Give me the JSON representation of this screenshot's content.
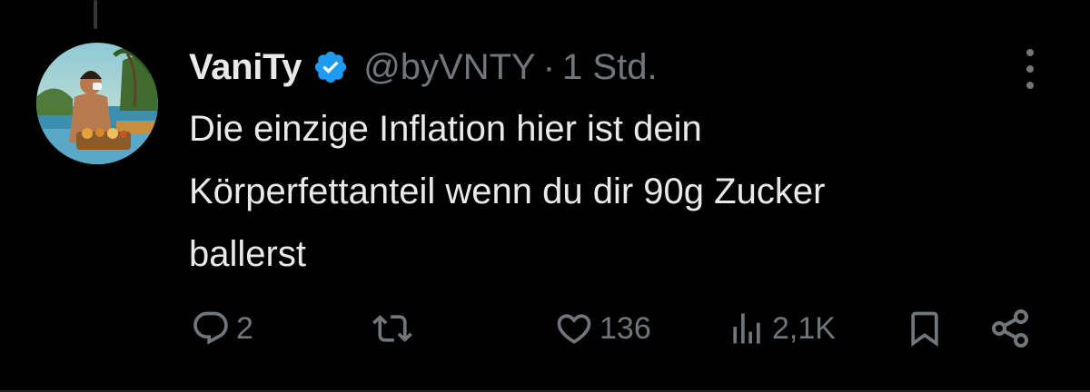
{
  "post": {
    "author_name": "VaniTy",
    "handle": "@byVNTY",
    "separator": "·",
    "time": "1 Std.",
    "text": "Die einzige Inflation hier ist dein\nKörperfettanteil wenn du dir 90g Zucker\nballerst"
  },
  "actions": {
    "reply_count": "2",
    "repost_count": "",
    "like_count": "136",
    "views_count": "2,1K"
  },
  "icons": {
    "verified": "verified-badge-icon",
    "more": "more-icon",
    "reply": "reply-icon",
    "repost": "repost-icon",
    "like": "heart-icon",
    "views": "views-icon",
    "bookmark": "bookmark-icon",
    "share": "share-icon"
  },
  "colors": {
    "background": "#000000",
    "text": "#e7e9ea",
    "muted": "#71767b",
    "verified": "#1d9bf0"
  }
}
